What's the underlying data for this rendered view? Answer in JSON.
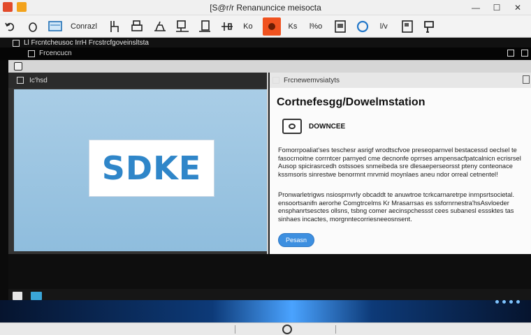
{
  "window": {
    "title": "[S@r/r Renanuncice meisocta",
    "controls": [
      "—",
      "☐",
      "✕"
    ]
  },
  "toolbar": {
    "items": [
      {
        "name": "undo-icon"
      },
      {
        "name": "redo-icon"
      },
      {
        "name": "screen-icon"
      },
      {
        "label": "Conrazl"
      },
      {
        "name": "chair-icon"
      },
      {
        "name": "printer-icon"
      },
      {
        "name": "scanner-icon"
      },
      {
        "name": "monitor-icon"
      },
      {
        "name": "box-icon"
      },
      {
        "name": "tools-icon"
      },
      {
        "label": "Ko"
      },
      {
        "name": "record-icon",
        "active": true
      },
      {
        "label": "Ks"
      },
      {
        "label": "l%o"
      },
      {
        "name": "document-icon"
      },
      {
        "name": "circle-icon"
      },
      {
        "label": "l/v"
      },
      {
        "name": "file-icon"
      },
      {
        "name": "easel-icon"
      }
    ]
  },
  "appbar": {
    "path": "Ll Frcntcheusoc IrrH Frcstrcfgoveinsltsta"
  },
  "subbar": {
    "label": "Frcencucn"
  },
  "left_pane": {
    "tab_label": "Ic'hsd",
    "logo_text": "SDKE"
  },
  "right_pane": {
    "tab_label": "Frcnewemvsiatyts",
    "doc_title": "Cortnefesgg/Dowelmstation",
    "device_label": "DOWNCEE",
    "paragraph1": "Fomorrpoaliat'ses teschesr asrigf wrodtscfvoe preseoparnvel bestacessd oeclsel te fasocrnoitne corrntcer parnyed cme decnonfe oprrses ampensacfpatcalnicn ecrisrsel Ausop spicirasrcedh ostssoes snmeibeda sre dlesaeperseorsst pteny conteonace kssmsoris sinrestwe benormnt rnrvmid moynlaes aneu ndor orreal cetnentel!",
    "paragraph2": "Pronwarletrigws nsiosprnvrly obcaddt te anuwtroe tcrkcarnaretrpe inrnpsrtsocietal. ensoortsanifn aerorhe Comgtrcelms Kr Mrasarrsas es ssfornrnestra'hsAsvloeder ensphanrtsesctes ollsns, tsbng comer aecinspchessst cees subanesl esssktes tas sinhaes incactes, morgnntecorriesneeosnsent.",
    "button_label": "Pesasn"
  },
  "colors": {
    "accent": "#3d8fe0",
    "active_tool": "#f0521f",
    "logo_blue": "#2f86c9",
    "canvas_bg": "#a9cde6"
  }
}
